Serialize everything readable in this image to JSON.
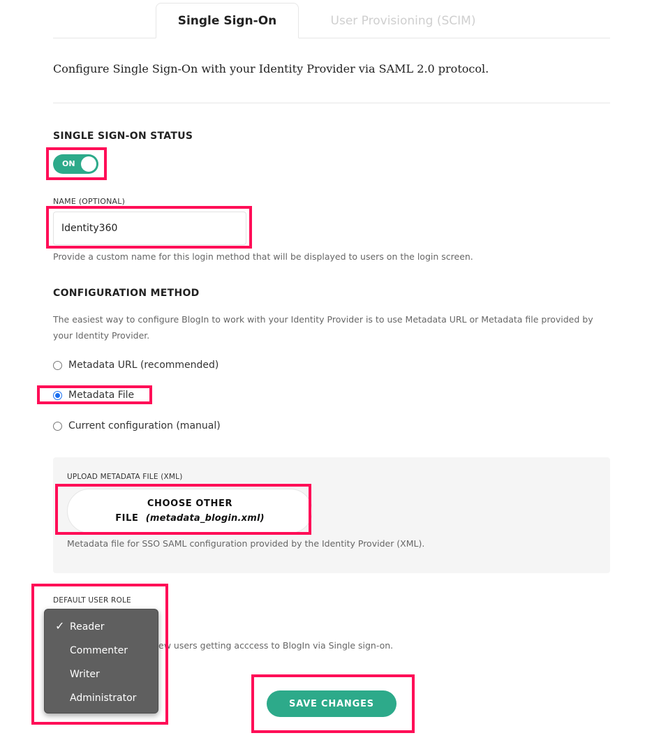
{
  "tabs": [
    {
      "label": "Single Sign-On",
      "active": true
    },
    {
      "label": "User Provisioning (SCIM)",
      "active": false
    }
  ],
  "intro": "Configure Single Sign-On with your Identity Provider via SAML 2.0 protocol.",
  "sso_status": {
    "title": "SINGLE SIGN-ON STATUS",
    "toggle_label": "ON",
    "enabled": true
  },
  "name_field": {
    "label": "NAME (OPTIONAL)",
    "value": "Identity360",
    "help": "Provide a custom name for this login method that will be displayed to users on the login screen."
  },
  "config_method": {
    "title": "CONFIGURATION METHOD",
    "description": "The easiest way to configure BlogIn to work with your Identity Provider is to use Metadata URL or Metadata file provided by your Identity Provider.",
    "options": [
      {
        "label": "Metadata URL (recommended)",
        "checked": false
      },
      {
        "label": "Metadata File",
        "checked": true
      },
      {
        "label": "Current configuration (manual)",
        "checked": false
      }
    ]
  },
  "upload": {
    "label": "UPLOAD METADATA FILE (XML)",
    "button_line1": "CHOOSE OTHER",
    "button_line2": "FILE",
    "file_name": "(metadata_blogin.xml)",
    "help": "Metadata file for SSO SAML configuration provided by the Identity Provider (XML)."
  },
  "default_role": {
    "label": "DEFAULT USER ROLE",
    "help_visible": "r new users getting acccess to BlogIn via Single sign-on.",
    "options": [
      "Reader",
      "Commenter",
      "Writer",
      "Administrator"
    ],
    "selected": "Reader",
    "check_mark": "✓"
  },
  "save_button": "SAVE CHANGES",
  "colors": {
    "accent": "#2daa8a",
    "highlight": "#ff0d57",
    "radio_selected": "#1a6ef0",
    "menu_bg": "#5f5f5f"
  }
}
